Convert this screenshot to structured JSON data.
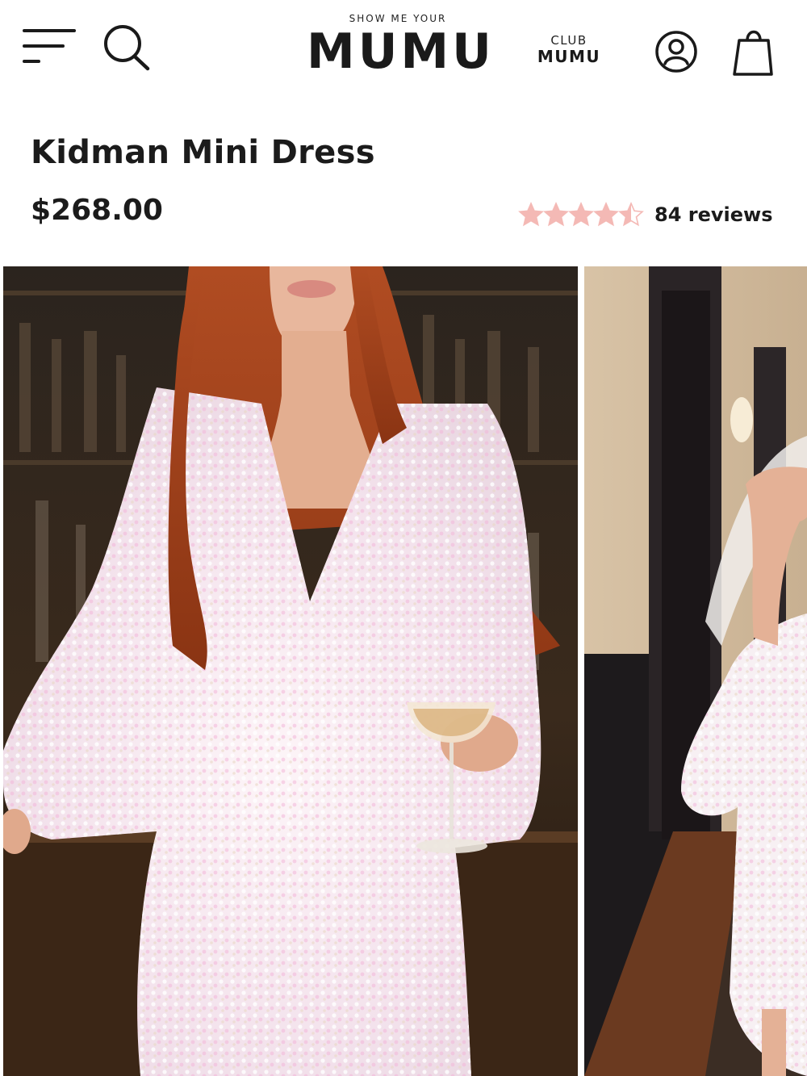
{
  "header": {
    "logo_top": "SHOW ME YOUR",
    "logo_main": "MUMU",
    "club_line1": "CLUB",
    "club_line2": "MUMU",
    "icons": [
      "menu-icon",
      "search-icon",
      "account-icon",
      "shopping-bag-icon"
    ]
  },
  "product": {
    "title": "Kidman Mini Dress",
    "price": "$268.00",
    "rating": 4.5,
    "rating_max": 5,
    "reviews_label": "84 reviews",
    "star_color": "#f4b9b5"
  },
  "gallery": {
    "images": [
      "model-in-white-sequin-dress-holding-cocktail",
      "model-in-hallway-with-veil"
    ]
  }
}
